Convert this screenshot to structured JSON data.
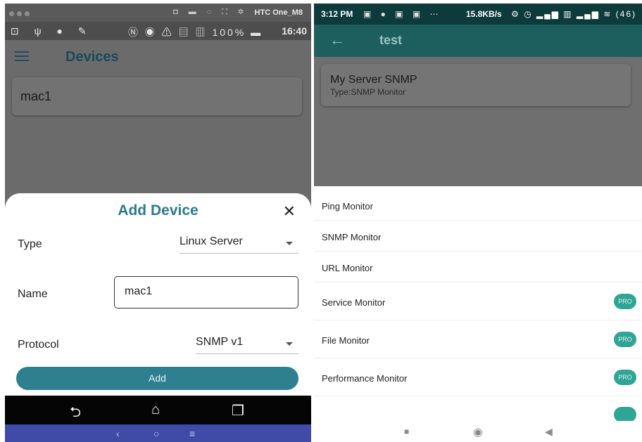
{
  "left": {
    "window": {
      "device_name": "HTC One_M8",
      "icons": "◘ ▬ ◌ ⛶ ✲"
    },
    "status": {
      "left_icons": "⊡ ψ ● ✎",
      "right_icons": "Ⓝ ◉ ⚠ ▤ ▥ 100% ▬",
      "time": "16:40"
    },
    "app": {
      "title": "Devices"
    },
    "device_card": {
      "name": "mac1"
    },
    "dialog": {
      "title": "Add Device",
      "close_glyph": "✕",
      "type_label": "Type",
      "type_value": "Linux Server",
      "name_label": "Name",
      "name_value": "mac1",
      "protocol_label": "Protocol",
      "protocol_value": "SNMP v1",
      "add_label": "Add"
    },
    "navbar": {
      "back": "⮌",
      "home": "⌂",
      "recents": "❐"
    },
    "bottombar": {
      "back": "‹",
      "home": "○",
      "menu": "≡"
    }
  },
  "right": {
    "status": {
      "time": "3:12 PM",
      "icons_mid": "▣ ● ▣ ▣ ⋯",
      "speed": "15.8KB/s",
      "icons_right": "⚙ ◷ ▂▄▆ ▥ ▂▄▆ ≋ (46)",
      "rows": []
    },
    "app": {
      "back_glyph": "←",
      "title": "test"
    },
    "server_card": {
      "name": "My Server SNMP",
      "type": "Type:SNMP Monitor"
    },
    "menu": [
      {
        "label": "Ping Monitor",
        "pro": ""
      },
      {
        "label": "SNMP Monitor",
        "pro": ""
      },
      {
        "label": "URL Monitor",
        "pro": ""
      },
      {
        "label": "Service Monitor",
        "pro": "PRO"
      },
      {
        "label": "File Monitor",
        "pro": "PRO"
      },
      {
        "label": "Performance Monitor",
        "pro": "PRO"
      }
    ],
    "navbar": {
      "recents": "■",
      "home": "◉",
      "back": "◀"
    }
  },
  "colors": {
    "teal_accent": "#2e7f8f",
    "app_bar_dark": "#1d5e5e",
    "status_dark": "#0d3a3a",
    "pro_badge": "#2fa596",
    "nav_blue": "#3f4ba6"
  }
}
